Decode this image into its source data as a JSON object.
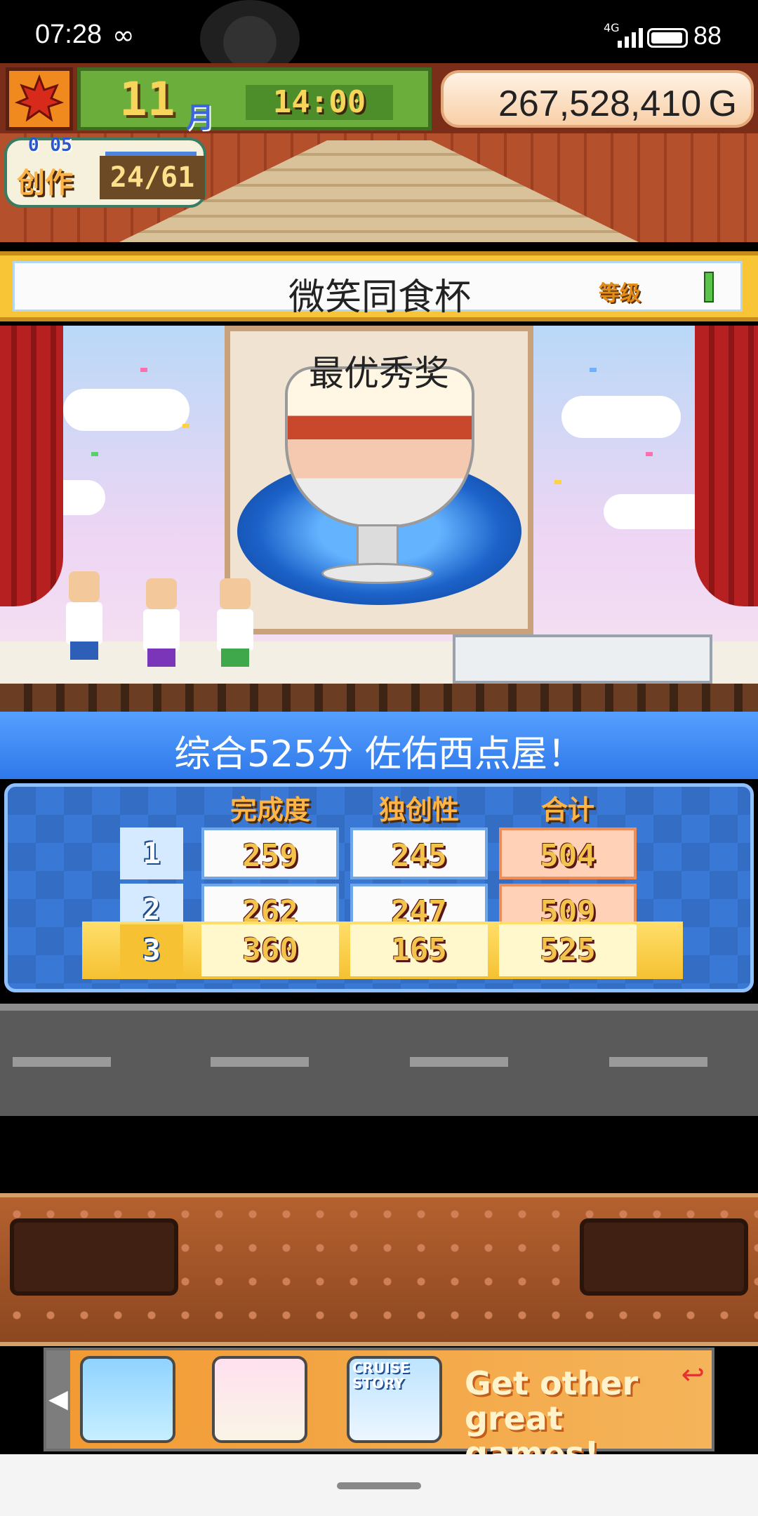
{
  "status_bar": {
    "time": "07:28",
    "network": "4G",
    "battery": "88"
  },
  "hud": {
    "season_icon": "maple-leaf-icon",
    "month": "11",
    "month_label": "月",
    "clock": "14:00",
    "gold": "267,528,410 G",
    "creation": {
      "label": "创作",
      "timer": "0 05",
      "count": "24/61"
    }
  },
  "contest": {
    "name": "微笑同食杯",
    "grade_label": "等级",
    "award": "最优秀奖"
  },
  "score": {
    "summary": "综合525分 佐佑西点屋！",
    "headers": [
      "完成度",
      "独创性",
      "合计"
    ],
    "rows": [
      {
        "rank": "1",
        "completion": "259",
        "originality": "245",
        "total": "504"
      },
      {
        "rank": "2",
        "completion": "262",
        "originality": "247",
        "total": "509"
      },
      {
        "rank": "3",
        "completion": "360",
        "originality": "165",
        "total": "525"
      }
    ]
  },
  "ad": {
    "cruise_label": "CRUISE STORY",
    "cta": "Get other great games!"
  },
  "colors": {
    "accent_blue": "#2f78ea",
    "gold_yellow": "#f7c535",
    "panel_blue": "#3a78d6"
  }
}
